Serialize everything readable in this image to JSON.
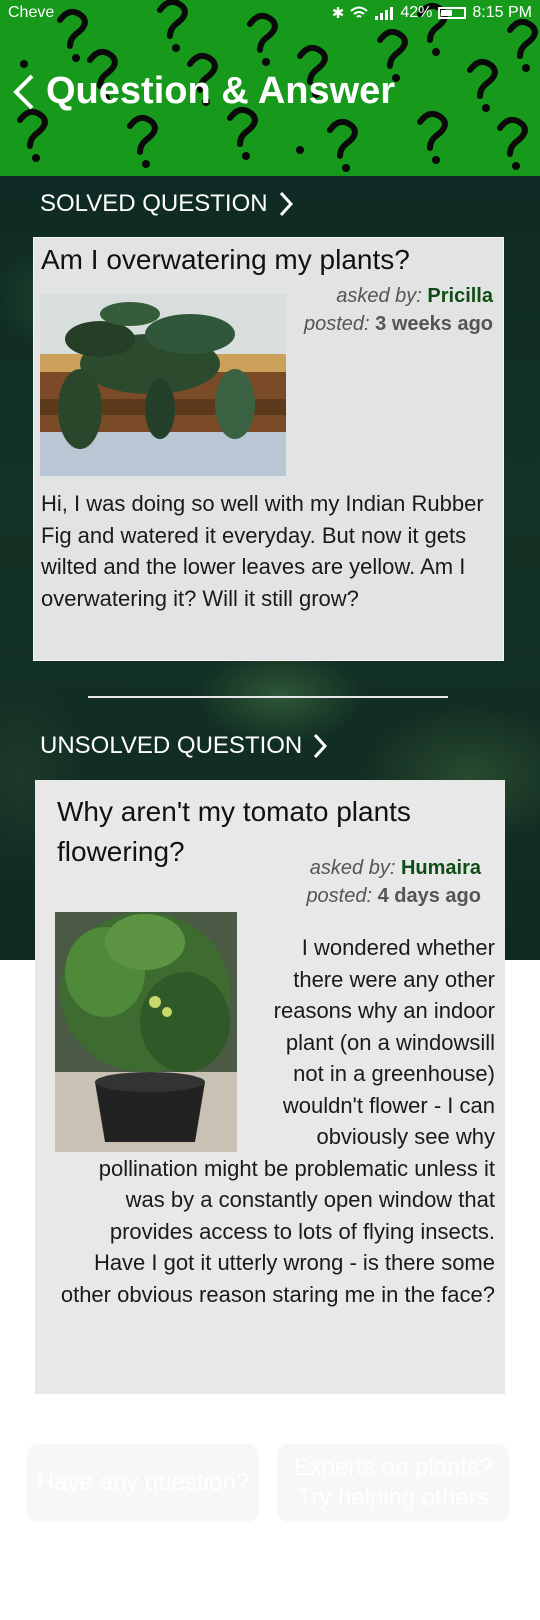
{
  "status_bar": {
    "carrier": "Cheve",
    "battery": "42%",
    "time": "8:15 PM",
    "icons": [
      "bluetooth-icon",
      "wifi-icon",
      "signal-icon",
      "battery-icon"
    ]
  },
  "header": {
    "title": "Question & Answer",
    "background_color": "#179a1c",
    "back_icon": "chevron-left-icon"
  },
  "solved_section": {
    "label": "SOLVED QUESTION",
    "question": {
      "title": "Am I overwatering my plants?",
      "asked_by_label": "asked by:",
      "asker": "Pricilla",
      "posted_label": "posted:",
      "posted": "3 weeks ago",
      "body": "Hi, I was doing so well with my Indian Rubber Fig and watered it everyday. But now it gets wilted and the lower leaves are yellow. Am I overwatering it? Will it still grow?"
    }
  },
  "unsolved_section": {
    "label": "UNSOLVED QUESTION",
    "question": {
      "title": "Why aren't my tomato plants flowering?",
      "asked_by_label": "asked by:",
      "asker": "Humaira",
      "posted_label": "posted:",
      "posted": "4 days ago",
      "body": "I wondered whether there were any other reasons why an indoor plant (on a windowsill not in a greenhouse) wouldn't flower - I can obviously see why pollination might be problematic unless it was by a constantly open window that provides access to lots of flying insects. Have I got it utterly wrong - is there some other obvious reason staring me in the face?"
    }
  },
  "actions": {
    "ask_label": "Have any question?",
    "help_label": "Experts on plants? Try helping others"
  }
}
